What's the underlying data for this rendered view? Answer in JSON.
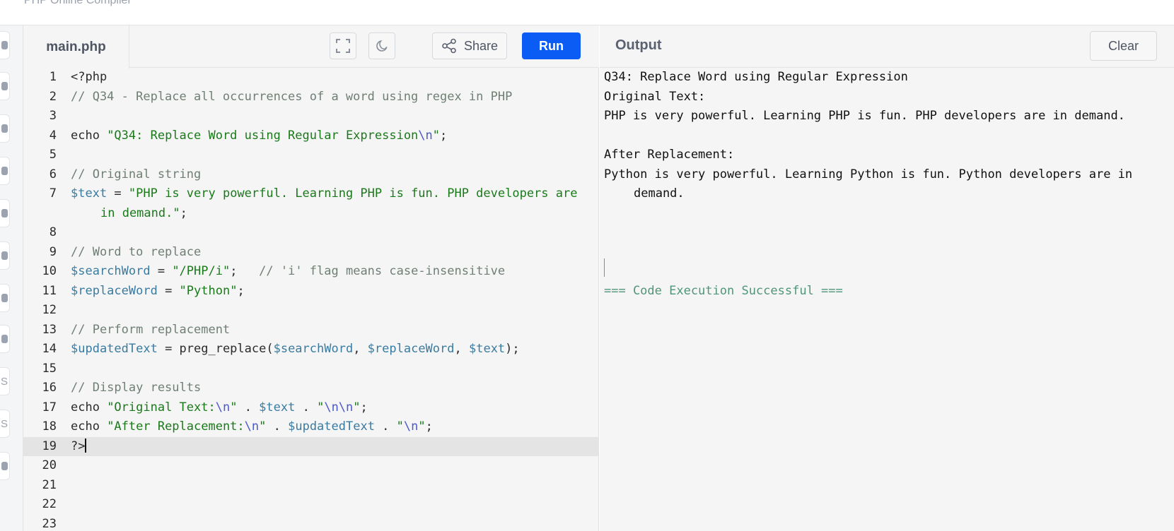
{
  "site": {
    "title": "PHP Online Compiler"
  },
  "sidebar": {
    "icons": [
      {
        "name": "python-icon"
      },
      {
        "name": "r-icon"
      },
      {
        "name": "database-icon"
      },
      {
        "name": "html-icon"
      },
      {
        "name": "java-icon"
      },
      {
        "name": "c-icon"
      },
      {
        "name": "cpp-icon"
      },
      {
        "name": "csharp-icon"
      },
      {
        "name": "js-icon",
        "text": "S"
      },
      {
        "name": "ts-icon",
        "text": "S"
      },
      {
        "name": "stack-icon"
      }
    ]
  },
  "editor": {
    "tab_label": "main.php",
    "share_label": "Share",
    "run_label": "Run",
    "lines": [
      {
        "n": "1",
        "segs": [
          {
            "c": "plain",
            "t": "<?php"
          }
        ]
      },
      {
        "n": "2",
        "segs": [
          {
            "c": "cm",
            "t": "// Q34 - Replace all occurrences of a word using regex in PHP"
          }
        ]
      },
      {
        "n": "3",
        "segs": []
      },
      {
        "n": "4",
        "segs": [
          {
            "c": "plain",
            "t": "echo "
          },
          {
            "c": "str",
            "t": "\"Q34: Replace Word using Regular Expression"
          },
          {
            "c": "esc",
            "t": "\\n"
          },
          {
            "c": "str",
            "t": "\""
          },
          {
            "c": "plain",
            "t": ";"
          }
        ]
      },
      {
        "n": "5",
        "segs": []
      },
      {
        "n": "6",
        "segs": [
          {
            "c": "cm",
            "t": "// Original string"
          }
        ]
      },
      {
        "n": "7",
        "wrap": true,
        "segs": [
          {
            "c": "var",
            "t": "$text"
          },
          {
            "c": "plain",
            "t": " = "
          },
          {
            "c": "str",
            "t": "\"PHP is very powerful. Learning PHP is fun. PHP developers are in demand.\""
          },
          {
            "c": "plain",
            "t": ";"
          }
        ]
      },
      {
        "n": "8",
        "segs": []
      },
      {
        "n": "9",
        "segs": [
          {
            "c": "cm",
            "t": "// Word to replace"
          }
        ]
      },
      {
        "n": "10",
        "segs": [
          {
            "c": "var",
            "t": "$searchWord"
          },
          {
            "c": "plain",
            "t": " = "
          },
          {
            "c": "str",
            "t": "\"/PHP/i\""
          },
          {
            "c": "plain",
            "t": ";   "
          },
          {
            "c": "cm",
            "t": "// 'i' flag means case-insensitive"
          }
        ]
      },
      {
        "n": "11",
        "segs": [
          {
            "c": "var",
            "t": "$replaceWord"
          },
          {
            "c": "plain",
            "t": " = "
          },
          {
            "c": "str",
            "t": "\"Python\""
          },
          {
            "c": "plain",
            "t": ";"
          }
        ]
      },
      {
        "n": "12",
        "segs": []
      },
      {
        "n": "13",
        "segs": [
          {
            "c": "cm",
            "t": "// Perform replacement"
          }
        ]
      },
      {
        "n": "14",
        "segs": [
          {
            "c": "var",
            "t": "$updatedText"
          },
          {
            "c": "plain",
            "t": " = preg_replace("
          },
          {
            "c": "var",
            "t": "$searchWord"
          },
          {
            "c": "plain",
            "t": ", "
          },
          {
            "c": "var",
            "t": "$replaceWord"
          },
          {
            "c": "plain",
            "t": ", "
          },
          {
            "c": "var",
            "t": "$text"
          },
          {
            "c": "plain",
            "t": ");"
          }
        ]
      },
      {
        "n": "15",
        "segs": []
      },
      {
        "n": "16",
        "segs": [
          {
            "c": "cm",
            "t": "// Display results"
          }
        ]
      },
      {
        "n": "17",
        "segs": [
          {
            "c": "plain",
            "t": "echo "
          },
          {
            "c": "str",
            "t": "\"Original Text:"
          },
          {
            "c": "esc",
            "t": "\\n"
          },
          {
            "c": "str",
            "t": "\""
          },
          {
            "c": "plain",
            "t": " . "
          },
          {
            "c": "var",
            "t": "$text"
          },
          {
            "c": "plain",
            "t": " . "
          },
          {
            "c": "str",
            "t": "\""
          },
          {
            "c": "esc",
            "t": "\\n\\n"
          },
          {
            "c": "str",
            "t": "\""
          },
          {
            "c": "plain",
            "t": ";"
          }
        ]
      },
      {
        "n": "18",
        "segs": [
          {
            "c": "plain",
            "t": "echo "
          },
          {
            "c": "str",
            "t": "\"After Replacement:"
          },
          {
            "c": "esc",
            "t": "\\n"
          },
          {
            "c": "str",
            "t": "\""
          },
          {
            "c": "plain",
            "t": " . "
          },
          {
            "c": "var",
            "t": "$updatedText"
          },
          {
            "c": "plain",
            "t": " . "
          },
          {
            "c": "str",
            "t": "\""
          },
          {
            "c": "esc",
            "t": "\\n"
          },
          {
            "c": "str",
            "t": "\""
          },
          {
            "c": "plain",
            "t": ";"
          }
        ]
      },
      {
        "n": "19",
        "active": true,
        "cursor": true,
        "segs": [
          {
            "c": "plain",
            "t": "?>"
          }
        ]
      },
      {
        "n": "20",
        "segs": []
      },
      {
        "n": "21",
        "segs": []
      },
      {
        "n": "22",
        "segs": []
      },
      {
        "n": "23",
        "segs": []
      }
    ]
  },
  "output": {
    "title": "Output",
    "clear_label": "Clear",
    "lines": [
      {
        "t": "Q34: Replace Word using Regular Expression"
      },
      {
        "t": "Original Text:"
      },
      {
        "t": "PHP is very powerful. Learning PHP is fun. PHP developers are in demand."
      },
      {
        "t": ""
      },
      {
        "t": "After Replacement:"
      },
      {
        "t": "Python is very powerful. Learning Python is fun. Python developers are in demand.",
        "wrap": true
      },
      {
        "t": ""
      },
      {
        "t": ""
      },
      {
        "t": ""
      },
      {
        "t": ""
      },
      {
        "t": "=== Code Execution Successful ===",
        "success": true
      }
    ]
  }
}
